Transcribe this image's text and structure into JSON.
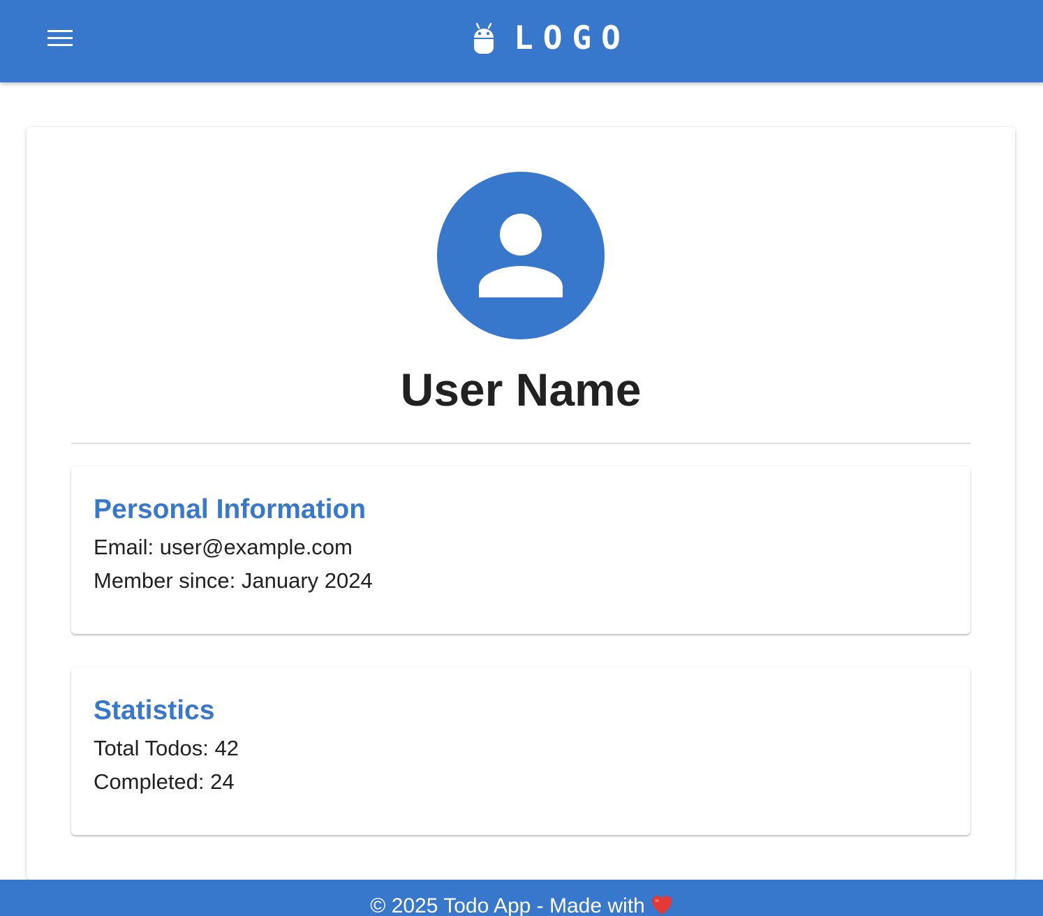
{
  "header": {
    "brand_text": "LOGO",
    "brand_icon": "android-icon",
    "menu_icon": "menu-icon"
  },
  "profile": {
    "avatar_icon": "account-circle-icon",
    "name": "User Name"
  },
  "personal_info": {
    "title": "Personal Information",
    "email_line": "Email: user@example.com",
    "member_since_line": "Member since: January 2024"
  },
  "statistics": {
    "title": "Statistics",
    "total_todos_line": "Total Todos: 42",
    "completed_line": "Completed: 24"
  },
  "footer": {
    "text": "© 2025 Todo App - Made with",
    "heart_icon": "heart-icon"
  },
  "colors": {
    "primary": "#3878cc",
    "text": "#212121",
    "heart": "#e53935"
  }
}
